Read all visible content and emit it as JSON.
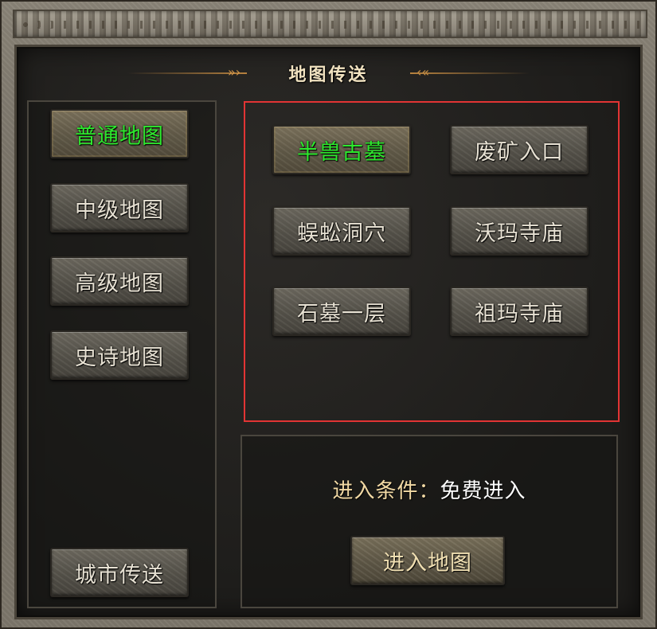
{
  "title": "地图传送",
  "colors": {
    "active_text": "#2ee82e",
    "selection_border": "#e23434",
    "title_accent": "#d79a4a"
  },
  "categories": [
    {
      "label": "普通地图",
      "active": true
    },
    {
      "label": "中级地图",
      "active": false
    },
    {
      "label": "高级地图",
      "active": false
    },
    {
      "label": "史诗地图",
      "active": false
    }
  ],
  "city_teleport_label": "城市传送",
  "maps": [
    {
      "label": "半兽古墓",
      "active": true
    },
    {
      "label": "废矿入口",
      "active": false
    },
    {
      "label": "蜈蚣洞穴",
      "active": false
    },
    {
      "label": "沃玛寺庙",
      "active": false
    },
    {
      "label": "石墓一层",
      "active": false
    },
    {
      "label": "祖玛寺庙",
      "active": false
    }
  ],
  "condition": {
    "label": "进入条件：",
    "value": "免费进入"
  },
  "enter_button_label": "进入地图"
}
